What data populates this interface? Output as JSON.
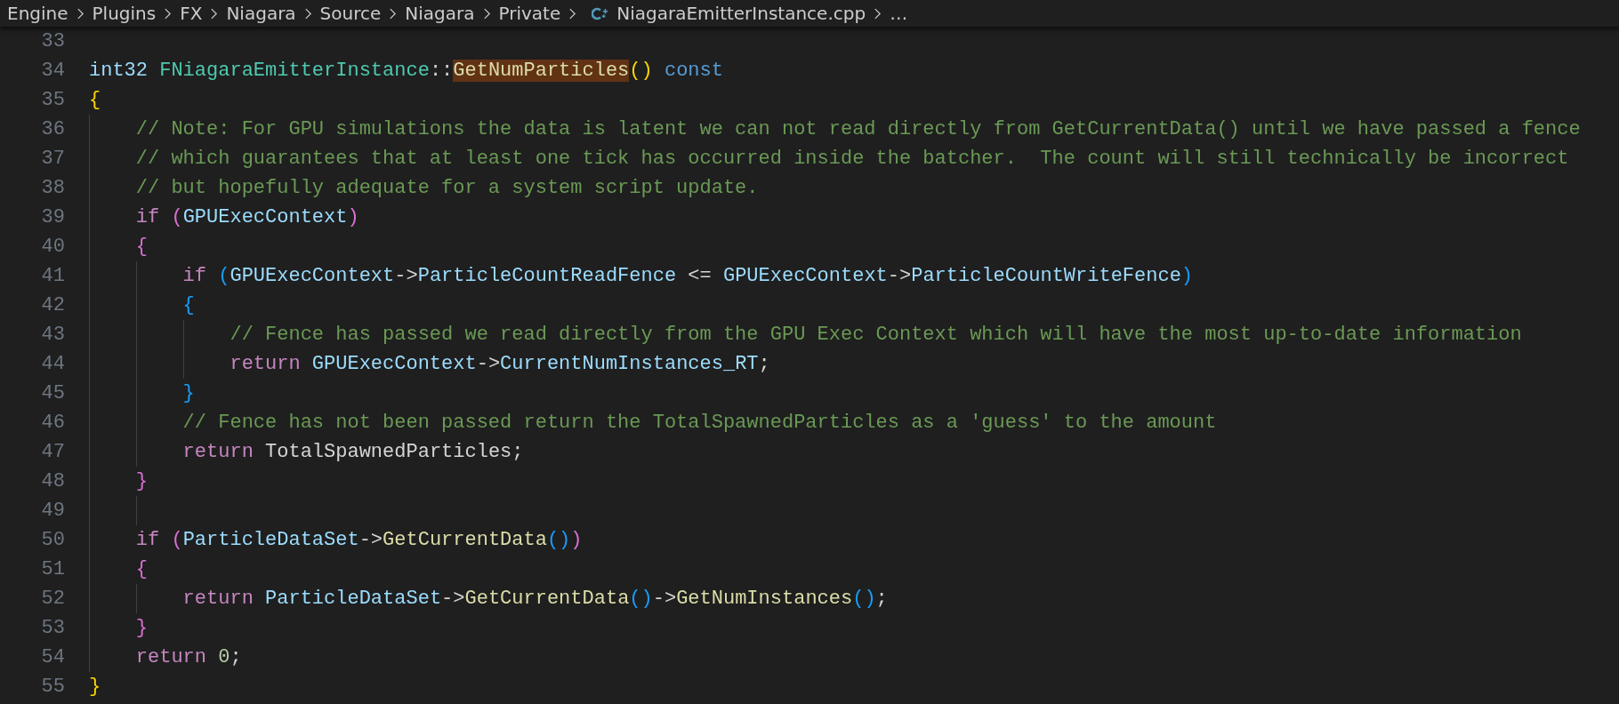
{
  "breadcrumbs": [
    {
      "label": "Engine",
      "kind": "folder"
    },
    {
      "label": "Plugins",
      "kind": "folder"
    },
    {
      "label": "FX",
      "kind": "folder"
    },
    {
      "label": "Niagara",
      "kind": "folder"
    },
    {
      "label": "Source",
      "kind": "folder"
    },
    {
      "label": "Niagara",
      "kind": "folder"
    },
    {
      "label": "Private",
      "kind": "folder"
    },
    {
      "label": "NiagaraEmitterInstance.cpp",
      "kind": "cpp-file"
    },
    {
      "label": "…",
      "kind": "symbol"
    }
  ],
  "lines": [
    {
      "number": "33"
    },
    {
      "number": "34",
      "tokens": [
        {
          "kind": "variable",
          "text": "int32 "
        },
        {
          "kind": "class",
          "text": "FNiagaraEmitterInstance"
        },
        {
          "kind": "plain",
          "text": "::"
        },
        {
          "kind": "match",
          "text": "GetNumParticles"
        },
        {
          "kind": "bracket1",
          "text": "()"
        },
        {
          "kind": "keyword",
          "text": " const"
        }
      ]
    },
    {
      "number": "35",
      "tokens": [
        {
          "kind": "bracket1",
          "text": "{"
        }
      ]
    },
    {
      "number": "36",
      "tokens": [
        {
          "kind": "comment",
          "text": "    // Note: For GPU simulations the data is latent we can not read directly from GetCurrentData() until we have passed a fence"
        }
      ]
    },
    {
      "number": "37",
      "tokens": [
        {
          "kind": "comment",
          "text": "    // which guarantees that at least one tick has occurred inside the batcher.  The count will still technically be incorrect"
        }
      ]
    },
    {
      "number": "38",
      "tokens": [
        {
          "kind": "comment",
          "text": "    // but hopefully adequate for a system script update."
        }
      ]
    },
    {
      "number": "39",
      "tokens": [
        {
          "kind": "control",
          "text": "    if "
        },
        {
          "kind": "bracket2",
          "text": "("
        },
        {
          "kind": "variable",
          "text": "GPUExecContext"
        },
        {
          "kind": "bracket2",
          "text": ")"
        }
      ]
    },
    {
      "number": "40",
      "tokens": [
        {
          "kind": "bracket2",
          "text": "    {"
        }
      ]
    },
    {
      "number": "41",
      "tokens": [
        {
          "kind": "control",
          "text": "        if "
        },
        {
          "kind": "bracket3",
          "text": "("
        },
        {
          "kind": "variable",
          "text": "GPUExecContext"
        },
        {
          "kind": "plain",
          "text": "->"
        },
        {
          "kind": "variable",
          "text": "ParticleCountReadFence"
        },
        {
          "kind": "plain",
          "text": " <= "
        },
        {
          "kind": "variable",
          "text": "GPUExecContext"
        },
        {
          "kind": "plain",
          "text": "->"
        },
        {
          "kind": "variable",
          "text": "ParticleCountWriteFence"
        },
        {
          "kind": "bracket3",
          "text": ")"
        }
      ]
    },
    {
      "number": "42",
      "tokens": [
        {
          "kind": "bracket3",
          "text": "        {"
        }
      ]
    },
    {
      "number": "43",
      "tokens": [
        {
          "kind": "comment",
          "text": "            // Fence has passed we read directly from the GPU Exec Context which will have the most up-to-date information"
        }
      ]
    },
    {
      "number": "44",
      "tokens": [
        {
          "kind": "control",
          "text": "            return "
        },
        {
          "kind": "variable",
          "text": "GPUExecContext"
        },
        {
          "kind": "plain",
          "text": "->"
        },
        {
          "kind": "variable",
          "text": "CurrentNumInstances_RT"
        },
        {
          "kind": "plain",
          "text": ";"
        }
      ]
    },
    {
      "number": "45",
      "tokens": [
        {
          "kind": "bracket3",
          "text": "        }"
        }
      ]
    },
    {
      "number": "46",
      "tokens": [
        {
          "kind": "comment",
          "text": "        // Fence has not been passed return the TotalSpawnedParticles as a 'guess' to the amount"
        }
      ]
    },
    {
      "number": "47",
      "tokens": [
        {
          "kind": "control",
          "text": "        return "
        },
        {
          "kind": "plain",
          "text": "TotalSpawnedParticles;"
        }
      ]
    },
    {
      "number": "48",
      "tokens": [
        {
          "kind": "bracket2",
          "text": "    }"
        }
      ]
    },
    {
      "number": "49"
    },
    {
      "number": "50",
      "tokens": [
        {
          "kind": "control",
          "text": "    if "
        },
        {
          "kind": "bracket2",
          "text": "("
        },
        {
          "kind": "variable",
          "text": "ParticleDataSet"
        },
        {
          "kind": "plain",
          "text": "->"
        },
        {
          "kind": "function",
          "text": "GetCurrentData"
        },
        {
          "kind": "bracket3",
          "text": "()"
        },
        {
          "kind": "bracket2",
          "text": ")"
        }
      ]
    },
    {
      "number": "51",
      "tokens": [
        {
          "kind": "bracket2",
          "text": "    {"
        }
      ]
    },
    {
      "number": "52",
      "tokens": [
        {
          "kind": "control",
          "text": "        return "
        },
        {
          "kind": "variable",
          "text": "ParticleDataSet"
        },
        {
          "kind": "plain",
          "text": "->"
        },
        {
          "kind": "function",
          "text": "GetCurrentData"
        },
        {
          "kind": "bracket3",
          "text": "()"
        },
        {
          "kind": "plain",
          "text": "->"
        },
        {
          "kind": "function",
          "text": "GetNumInstances"
        },
        {
          "kind": "bracket3",
          "text": "()"
        },
        {
          "kind": "plain",
          "text": ";"
        }
      ]
    },
    {
      "number": "53",
      "tokens": [
        {
          "kind": "bracket2",
          "text": "    }"
        }
      ]
    },
    {
      "number": "54",
      "tokens": [
        {
          "kind": "control",
          "text": "    return "
        },
        {
          "kind": "number",
          "text": "0"
        },
        {
          "kind": "plain",
          "text": ";"
        }
      ]
    },
    {
      "number": "55",
      "tokens": [
        {
          "kind": "bracket1",
          "text": "}"
        }
      ]
    }
  ]
}
